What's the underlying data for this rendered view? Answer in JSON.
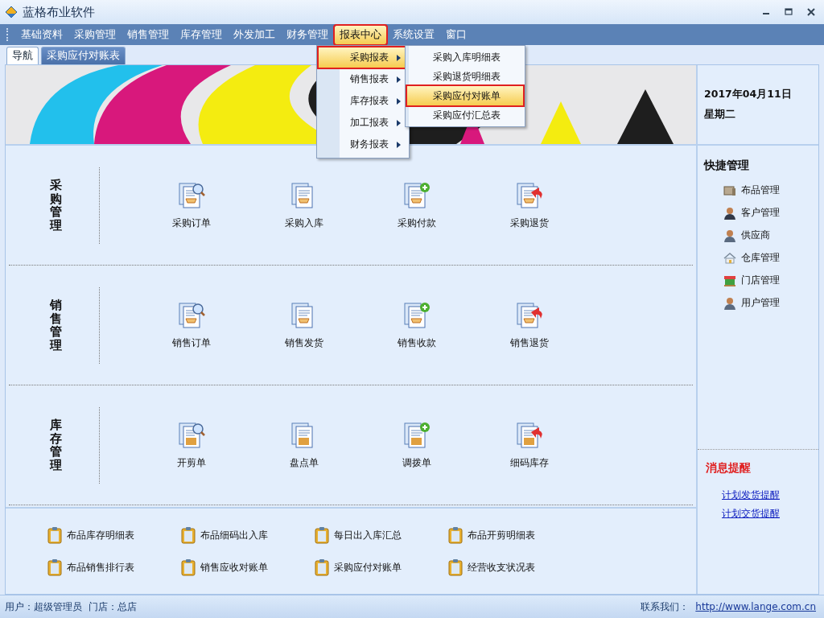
{
  "window": {
    "title": "蓝格布业软件"
  },
  "menu": [
    {
      "label": "基础资料",
      "selected": false
    },
    {
      "label": "采购管理",
      "selected": false
    },
    {
      "label": "销售管理",
      "selected": false
    },
    {
      "label": "库存管理",
      "selected": false
    },
    {
      "label": "外发加工",
      "selected": false
    },
    {
      "label": "财务管理",
      "selected": false
    },
    {
      "label": "报表中心",
      "selected": true
    },
    {
      "label": "系统设置",
      "selected": false
    },
    {
      "label": "窗口",
      "selected": false
    }
  ],
  "tabs": [
    {
      "label": "导航",
      "selected": true
    },
    {
      "label": "采购应付对账表",
      "selected": false
    }
  ],
  "dropdown": [
    {
      "label": "采购报表",
      "selected": true
    },
    {
      "label": "销售报表",
      "selected": false
    },
    {
      "label": "库存报表",
      "selected": false
    },
    {
      "label": "加工报表",
      "selected": false
    },
    {
      "label": "财务报表",
      "selected": false
    }
  ],
  "submenu": [
    {
      "label": "采购入库明细表",
      "selected": false
    },
    {
      "label": "采购退货明细表",
      "selected": false
    },
    {
      "label": "采购应付对账单",
      "selected": true
    },
    {
      "label": "采购应付汇总表",
      "selected": false
    }
  ],
  "date": {
    "date": "2017年04月11日",
    "weekday": "星期二"
  },
  "sections": [
    {
      "title": "采购管理",
      "items": [
        "采购订单",
        "采购入库",
        "采购付款",
        "采购退货"
      ]
    },
    {
      "title": "销售管理",
      "items": [
        "销售订单",
        "销售发货",
        "销售收款",
        "销售退货"
      ]
    },
    {
      "title": "库存管理",
      "items": [
        "开剪单",
        "盘点单",
        "调拨单",
        "细码库存"
      ]
    }
  ],
  "reports": [
    "布品库存明细表",
    "布品细码出入库",
    "每日出入库汇总",
    "布品开剪明细表",
    "布品销售排行表",
    "销售应收对账单",
    "采购应付对账单",
    "经营收支状况表"
  ],
  "quick": {
    "title": "快捷管理",
    "items": [
      "布品管理",
      "客户管理",
      "供应商",
      "仓库管理",
      "门店管理",
      "用户管理"
    ]
  },
  "messages": {
    "title": "消息提醒",
    "links": [
      "计划发货提醒",
      "计划交货提醒"
    ]
  },
  "status_bar": {
    "user": "用户：超级管理员",
    "store": "门店：总店",
    "contact": "联系我们：",
    "url": "http://www.lange.com.cn"
  }
}
